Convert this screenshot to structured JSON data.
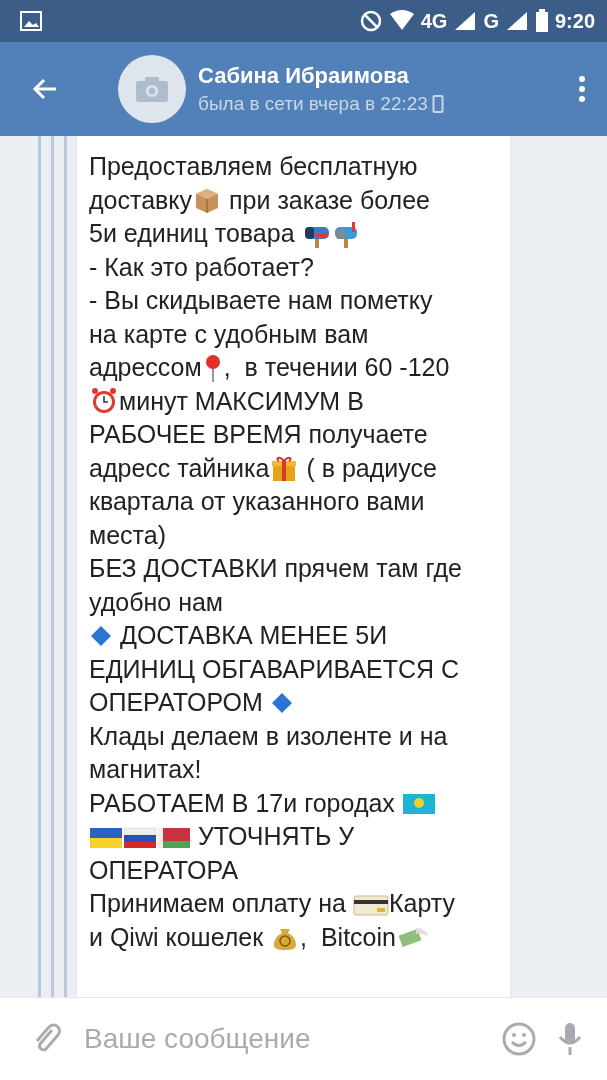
{
  "status_bar": {
    "network_1": "4G",
    "network_2": "G",
    "time": "9:20"
  },
  "header": {
    "name": "Сабина Ибраимова",
    "last_seen": "была в сети вчера в 22:23"
  },
  "message": {
    "lines": [
      [
        {
          "kind": "text",
          "text": "Предоставляем бесплатную"
        }
      ],
      [
        {
          "kind": "text",
          "text": "доставку"
        },
        {
          "kind": "package"
        },
        {
          "kind": "text",
          "text": " при заказе более"
        }
      ],
      [
        {
          "kind": "text",
          "text": "5и единиц товара "
        },
        {
          "kind": "mailbox_closed"
        },
        {
          "kind": "mailbox_open"
        }
      ],
      [
        {
          "kind": "text",
          "text": "- Как это работает?"
        }
      ],
      [
        {
          "kind": "text",
          "text": "- Вы скидываете нам пометку"
        }
      ],
      [
        {
          "kind": "text",
          "text": "на карте с удобным вам"
        }
      ],
      [
        {
          "kind": "text",
          "text": "адрессом"
        },
        {
          "kind": "pin"
        },
        {
          "kind": "text",
          "text": ",  в течении 60 -120"
        }
      ],
      [
        {
          "kind": "clock"
        },
        {
          "kind": "text",
          "text": "минут МАКСИМУМ В"
        }
      ],
      [
        {
          "kind": "text",
          "text": "РАБОЧЕЕ ВРЕМЯ получаете"
        }
      ],
      [
        {
          "kind": "text",
          "text": "адресс тайника"
        },
        {
          "kind": "gift"
        },
        {
          "kind": "text",
          "text": " ( в радиусе"
        }
      ],
      [
        {
          "kind": "text",
          "text": "квартала от указанного вами"
        }
      ],
      [
        {
          "kind": "text",
          "text": "места)"
        }
      ],
      [
        {
          "kind": "text",
          "text": "БЕЗ ДОСТАВКИ прячем там где"
        }
      ],
      [
        {
          "kind": "text",
          "text": "удобно нам"
        }
      ],
      [
        {
          "kind": "diamond"
        },
        {
          "kind": "text",
          "text": " ДОСТАВКА МЕНЕЕ 5И"
        }
      ],
      [
        {
          "kind": "text",
          "text": "ЕДИНИЦ ОБГАВАРИВАЕТСЯ С"
        }
      ],
      [
        {
          "kind": "text",
          "text": "ОПЕРАТОРОМ "
        },
        {
          "kind": "diamond"
        }
      ],
      [
        {
          "kind": "text",
          "text": "Клады делаем в изоленте и на"
        }
      ],
      [
        {
          "kind": "text",
          "text": "магнитах!"
        }
      ],
      [
        {
          "kind": "text",
          "text": "РАБОТАЕМ В 17и городах "
        },
        {
          "kind": "flag_kz"
        }
      ],
      [
        {
          "kind": "flag_ua"
        },
        {
          "kind": "flag_ru"
        },
        {
          "kind": "flag_by"
        },
        {
          "kind": "text",
          "text": " УТОЧНЯТЬ У"
        }
      ],
      [
        {
          "kind": "text",
          "text": "ОПЕРАТОРА"
        }
      ],
      [
        {
          "kind": "text",
          "text": "Принимаем оплату на "
        },
        {
          "kind": "card"
        },
        {
          "kind": "text",
          "text": "Карту"
        }
      ],
      [
        {
          "kind": "text",
          "text": "и Qiwi кошелек "
        },
        {
          "kind": "moneybag"
        },
        {
          "kind": "text",
          "text": ",  Bitcoin"
        },
        {
          "kind": "money_wings"
        }
      ]
    ]
  },
  "composer": {
    "placeholder": "Ваше сообщение"
  }
}
